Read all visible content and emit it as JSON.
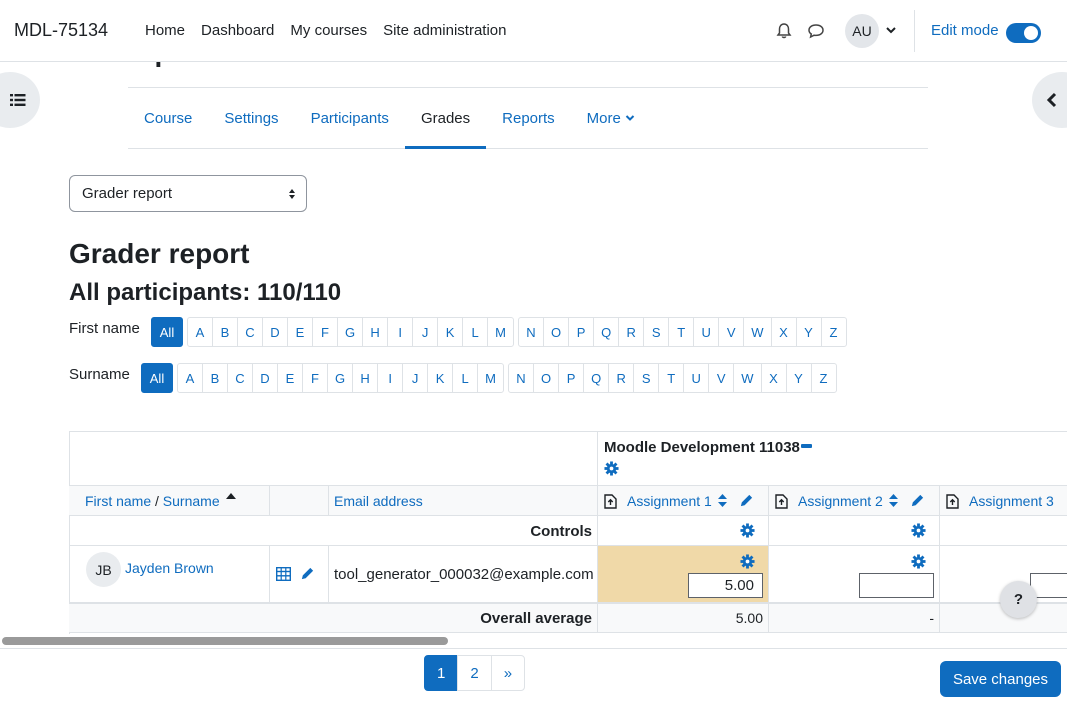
{
  "navbar": {
    "brand": "MDL-75134",
    "items": [
      "Home",
      "Dashboard",
      "My courses",
      "Site administration"
    ],
    "user_initials": "AU",
    "edit_mode_label": "Edit mode",
    "edit_mode_on": true
  },
  "page": {
    "course_title_visible": "report",
    "report_select_value": "Grader report",
    "heading": "Grader report",
    "subheading": "All participants: 110/110"
  },
  "secondary_nav": {
    "tabs": [
      "Course",
      "Settings",
      "Participants",
      "Grades",
      "Reports",
      "More"
    ],
    "active_tab": "Grades"
  },
  "initials": {
    "firstname_label": "First name",
    "surname_label": "Surname",
    "all_label": "All",
    "group1": [
      "A",
      "B",
      "C",
      "D",
      "E",
      "F",
      "G",
      "H",
      "I",
      "J",
      "K",
      "L",
      "M"
    ],
    "group2": [
      "N",
      "O",
      "P",
      "Q",
      "R",
      "S",
      "T",
      "U",
      "V",
      "W",
      "X",
      "Y",
      "Z"
    ]
  },
  "grader": {
    "category_name": "Moodle Development 11038",
    "col_firstname": "First name",
    "col_separator": " / ",
    "col_surname": "Surname",
    "col_email": "Email address",
    "assignments": [
      "Assignment 1",
      "Assignment 2",
      "Assignment 3"
    ],
    "controls_label": "Controls",
    "student": {
      "initials": "JB",
      "name": "Jayden Brown",
      "email": "tool_generator_000032@example.com",
      "grades": [
        "5.00",
        "",
        ""
      ]
    },
    "overall_average_label": "Overall average",
    "averages": [
      "5.00",
      "-",
      ""
    ]
  },
  "pagination": {
    "pages": [
      "1",
      "2"
    ],
    "next": "»",
    "current": "1"
  },
  "actions": {
    "save_label": "Save changes",
    "help_label": "?"
  },
  "colors": {
    "accent": "#0f6cbf",
    "highlight_cell": "#f0d9a8"
  }
}
